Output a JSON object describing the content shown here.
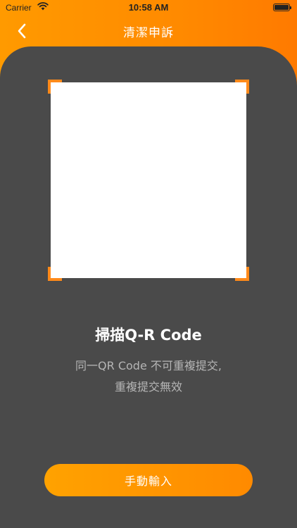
{
  "status_bar": {
    "carrier": "Carrier",
    "time": "10:58 AM"
  },
  "nav": {
    "title": "清潔申訴",
    "back_icon": "chevron-left-icon"
  },
  "scanner": {
    "title": "掃描Q-R Code",
    "note_line1": "同一QR Code 不可重複提交,",
    "note_line2": "重複提交無效"
  },
  "actions": {
    "manual_input_label": "手動輸入"
  },
  "colors": {
    "accent": "#ff8a00",
    "background": "#4a4a4a",
    "corner": "#ff8a1a"
  }
}
